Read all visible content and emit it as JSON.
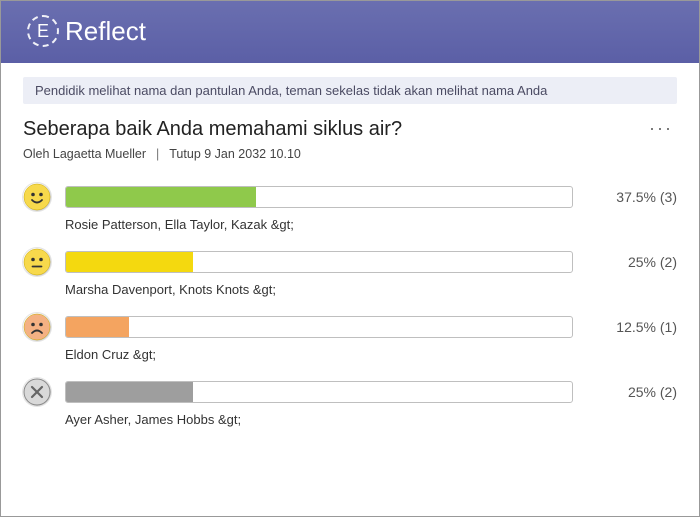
{
  "header": {
    "logo_letter": "E",
    "app_name": "Reflect"
  },
  "notice": "Pendidik melihat nama dan pantulan Anda, teman sekelas tidak akan melihat nama Anda",
  "question": "Seberapa baik Anda memahami siklus air?",
  "byline_prefix": "Oleh",
  "author": "Lagaetta Mueller",
  "close_label": "Tutup 9 Jan 2032 10.10",
  "more_glyph": "···",
  "rows": [
    {
      "emoji": "happy",
      "emoji_bg": "#f7d94c",
      "fill_color": "#8fc94b",
      "percent": 37.5,
      "count": 3,
      "pct_text": "37.5% (3)",
      "names": "Rosie Patterson, Ella Taylor, Kazak &gt;"
    },
    {
      "emoji": "neutral",
      "emoji_bg": "#f7d94c",
      "fill_color": "#f4d90f",
      "percent": 25,
      "count": 2,
      "pct_text": "25% (2)",
      "names": "Marsha Davenport, Knots Knots &gt;"
    },
    {
      "emoji": "sad",
      "emoji_bg": "#f4b183",
      "fill_color": "#f4a460",
      "percent": 12.5,
      "count": 1,
      "pct_text": "12.5% (1)",
      "names": "Eldon Cruz &gt;"
    },
    {
      "emoji": "none",
      "emoji_bg": "#d9d9d9",
      "fill_color": "#9e9e9e",
      "percent": 25,
      "count": 2,
      "pct_text": "25% (2)",
      "names": "Ayer Asher, James Hobbs &gt;"
    }
  ]
}
